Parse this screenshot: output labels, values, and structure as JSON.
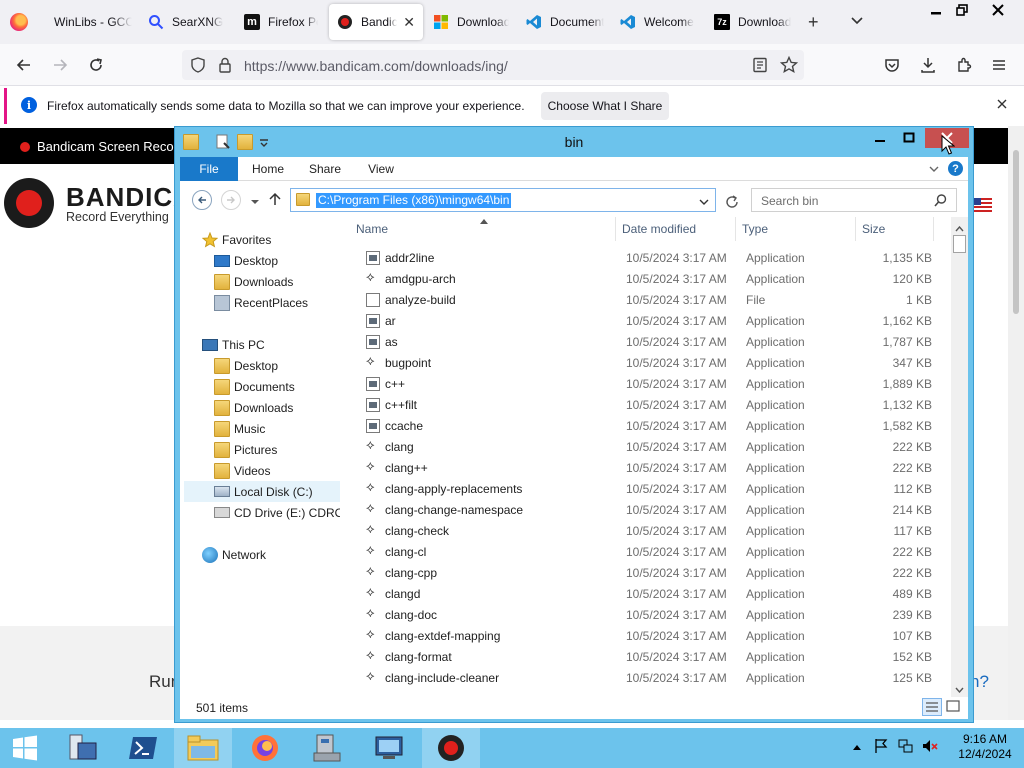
{
  "browser": {
    "tabs": [
      {
        "label": "WinLibs - GCC",
        "icon": "winlibs-icon"
      },
      {
        "label": "SearXNG",
        "icon": "search-icon"
      },
      {
        "label": "Firefox Portable",
        "icon": "m-logo-icon"
      },
      {
        "label": "Bandicam",
        "icon": "bandicam-icon",
        "active": true
      },
      {
        "label": "Download",
        "icon": "microsoft-icon"
      },
      {
        "label": "Documentation",
        "icon": "vscode-icon"
      },
      {
        "label": "Welcome",
        "icon": "vscode-icon"
      },
      {
        "label": "Download",
        "icon": "7zip-icon"
      }
    ],
    "tab_close": "✕",
    "new_tab": "+",
    "url": "https://www.bandicam.com/downloads/ing/",
    "infobar": {
      "message": "Firefox automatically sends some data to Mozilla so that we can improve your experience.",
      "button": "Choose What I Share",
      "info_glyph": "i"
    }
  },
  "page": {
    "topbar_title": "Bandicam Screen Recorder",
    "brand": "BANDICAM",
    "tagline": "Record Everything",
    "footer_run": "Run",
    "footer_help": "n?"
  },
  "explorer": {
    "title": "bin",
    "ribbon_tabs": [
      "File",
      "Home",
      "Share",
      "View"
    ],
    "address": "C:\\Program Files (x86)\\mingw64\\bin",
    "search_placeholder": "Search bin",
    "help_glyph": "?",
    "nav": {
      "favorites": "Favorites",
      "fav_items": [
        "Desktop",
        "Downloads",
        "RecentPlaces"
      ],
      "this_pc": "This PC",
      "pc_items": [
        "Desktop",
        "Documents",
        "Downloads",
        "Music",
        "Pictures",
        "Videos",
        "Local Disk (C:)",
        "CD Drive (E:) CDROM"
      ],
      "network": "Network"
    },
    "columns": [
      "Name",
      "Date modified",
      "Type",
      "Size"
    ],
    "files": [
      {
        "name": "addr2line",
        "date": "10/5/2024 3:17 AM",
        "type": "Application",
        "size": "1,135 KB",
        "icon": "app"
      },
      {
        "name": "amdgpu-arch",
        "date": "10/5/2024 3:17 AM",
        "type": "Application",
        "size": "120 KB",
        "icon": "gnu"
      },
      {
        "name": "analyze-build",
        "date": "10/5/2024 3:17 AM",
        "type": "File",
        "size": "1 KB",
        "icon": "file"
      },
      {
        "name": "ar",
        "date": "10/5/2024 3:17 AM",
        "type": "Application",
        "size": "1,162 KB",
        "icon": "app"
      },
      {
        "name": "as",
        "date": "10/5/2024 3:17 AM",
        "type": "Application",
        "size": "1,787 KB",
        "icon": "app"
      },
      {
        "name": "bugpoint",
        "date": "10/5/2024 3:17 AM",
        "type": "Application",
        "size": "347 KB",
        "icon": "gnu"
      },
      {
        "name": "c++",
        "date": "10/5/2024 3:17 AM",
        "type": "Application",
        "size": "1,889 KB",
        "icon": "app"
      },
      {
        "name": "c++filt",
        "date": "10/5/2024 3:17 AM",
        "type": "Application",
        "size": "1,132 KB",
        "icon": "app"
      },
      {
        "name": "ccache",
        "date": "10/5/2024 3:17 AM",
        "type": "Application",
        "size": "1,582 KB",
        "icon": "app"
      },
      {
        "name": "clang",
        "date": "10/5/2024 3:17 AM",
        "type": "Application",
        "size": "222 KB",
        "icon": "gnu"
      },
      {
        "name": "clang++",
        "date": "10/5/2024 3:17 AM",
        "type": "Application",
        "size": "222 KB",
        "icon": "gnu"
      },
      {
        "name": "clang-apply-replacements",
        "date": "10/5/2024 3:17 AM",
        "type": "Application",
        "size": "112 KB",
        "icon": "gnu"
      },
      {
        "name": "clang-change-namespace",
        "date": "10/5/2024 3:17 AM",
        "type": "Application",
        "size": "214 KB",
        "icon": "gnu"
      },
      {
        "name": "clang-check",
        "date": "10/5/2024 3:17 AM",
        "type": "Application",
        "size": "117 KB",
        "icon": "gnu"
      },
      {
        "name": "clang-cl",
        "date": "10/5/2024 3:17 AM",
        "type": "Application",
        "size": "222 KB",
        "icon": "gnu"
      },
      {
        "name": "clang-cpp",
        "date": "10/5/2024 3:17 AM",
        "type": "Application",
        "size": "222 KB",
        "icon": "gnu"
      },
      {
        "name": "clangd",
        "date": "10/5/2024 3:17 AM",
        "type": "Application",
        "size": "489 KB",
        "icon": "gnu"
      },
      {
        "name": "clang-doc",
        "date": "10/5/2024 3:17 AM",
        "type": "Application",
        "size": "239 KB",
        "icon": "gnu"
      },
      {
        "name": "clang-extdef-mapping",
        "date": "10/5/2024 3:17 AM",
        "type": "Application",
        "size": "107 KB",
        "icon": "gnu"
      },
      {
        "name": "clang-format",
        "date": "10/5/2024 3:17 AM",
        "type": "Application",
        "size": "152 KB",
        "icon": "gnu"
      },
      {
        "name": "clang-include-cleaner",
        "date": "10/5/2024 3:17 AM",
        "type": "Application",
        "size": "125 KB",
        "icon": "gnu"
      }
    ],
    "item_count": "501 items"
  },
  "taskbar": {
    "time": "9:16 AM",
    "date": "12/4/2024"
  },
  "colors": {
    "taskbar": "#6cc3ec",
    "explorer_frame": "#6cc3ec",
    "close_red": "#c75050",
    "selection": "#3399ff",
    "file_tab": "#1979ca"
  }
}
